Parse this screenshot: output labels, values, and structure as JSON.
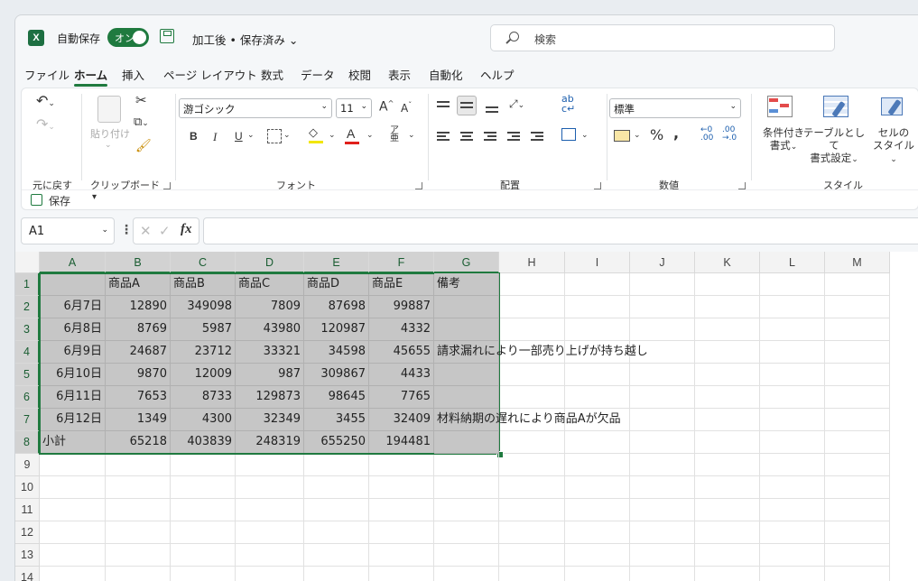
{
  "app": {
    "logo": "X",
    "autosave_label": "自動保存",
    "autosave_state": "オン",
    "doc_title": "加工後 • 保存済み",
    "doc_chevron": "⌄"
  },
  "search": {
    "placeholder": "検索"
  },
  "tabs": [
    "ファイル",
    "ホーム",
    "挿入",
    "ページ レイアウト",
    "数式",
    "データ",
    "校閲",
    "表示",
    "自動化",
    "ヘルプ"
  ],
  "active_tab": "ホーム",
  "ribbon": {
    "groups": {
      "undo": "元に戻す",
      "clipboard": "クリップボード",
      "font": "フォント",
      "alignment": "配置",
      "number": "数値",
      "styles": "スタイル"
    },
    "paste_label": "貼り付け",
    "font_name": "游ゴシック",
    "font_size": "11",
    "bold": "B",
    "italic": "I",
    "underline": "U",
    "font_color_glyph": "A",
    "number_format": "標準",
    "percent": "%",
    "style_buttons": {
      "cond_l1": "条件付き",
      "cond_l2": "書式",
      "table_l1": "テーブルとして",
      "table_l2": "書式設定",
      "cell_l1": "セルの",
      "cell_l2": "スタイル"
    },
    "qat_save": "保存"
  },
  "formula_bar": {
    "name_box": "A1",
    "fx": "fx",
    "cancel": "✕",
    "enter": "✓",
    "value": ""
  },
  "colors": {
    "accent": "#1f7a3f",
    "selection_fill": "#c6c6c6"
  },
  "sheet": {
    "columns": [
      "A",
      "B",
      "C",
      "D",
      "E",
      "F",
      "G",
      "H",
      "I",
      "J",
      "K",
      "L",
      "M"
    ],
    "rows": [
      "1",
      "2",
      "3",
      "4",
      "5",
      "6",
      "7",
      "8",
      "9",
      "10",
      "11",
      "12",
      "13",
      "14"
    ],
    "cells": [
      [
        "",
        "商品A",
        "商品B",
        "商品C",
        "商品D",
        "商品E",
        "備考"
      ],
      [
        "6月7日",
        "12890",
        "349098",
        "7809",
        "87698",
        "99887",
        ""
      ],
      [
        "6月8日",
        "8769",
        "5987",
        "43980",
        "120987",
        "4332",
        ""
      ],
      [
        "6月9日",
        "24687",
        "23712",
        "33321",
        "34598",
        "45655",
        "請求漏れにより一部売り上げが持ち越し"
      ],
      [
        "6月10日",
        "9870",
        "12009",
        "987",
        "309867",
        "4433",
        ""
      ],
      [
        "6月11日",
        "7653",
        "8733",
        "129873",
        "98645",
        "7765",
        ""
      ],
      [
        "6月12日",
        "1349",
        "4300",
        "32349",
        "3455",
        "32409",
        "材料納期の遅れにより商品Aが欠品"
      ],
      [
        "小計",
        "65218",
        "403839",
        "248319",
        "655250",
        "194481",
        ""
      ]
    ]
  }
}
